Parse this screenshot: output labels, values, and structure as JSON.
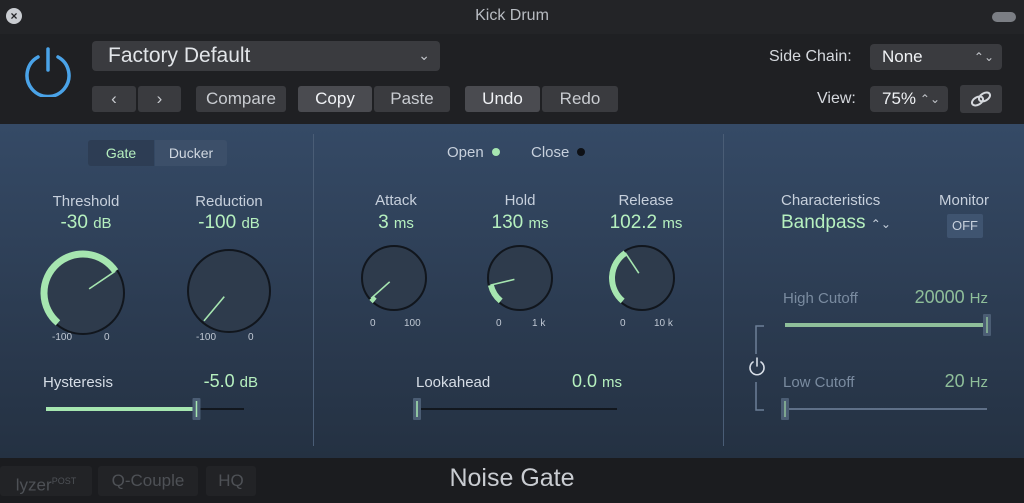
{
  "window": {
    "title": "Kick Drum",
    "plugin_name": "Noise Gate"
  },
  "header": {
    "preset": "Factory Default",
    "nav_prev": "‹",
    "nav_next": "›",
    "compare": "Compare",
    "copy": "Copy",
    "paste": "Paste",
    "undo": "Undo",
    "redo": "Redo",
    "side_chain_label": "Side Chain:",
    "side_chain_value": "None",
    "view_label": "View:",
    "view_value": "75%"
  },
  "mode": {
    "gate": "Gate",
    "ducker": "Ducker",
    "selected": "Gate"
  },
  "indicators": {
    "open": "Open",
    "close": "Close"
  },
  "knobs": {
    "threshold": {
      "label": "Threshold",
      "value": "-30",
      "unit": "dB",
      "min": "-100",
      "max": "0",
      "level": 0.7
    },
    "reduction": {
      "label": "Reduction",
      "value": "-100",
      "unit": "dB",
      "min": "-100",
      "max": "0",
      "level": 0.0
    },
    "attack": {
      "label": "Attack",
      "value": "3",
      "unit": "ms",
      "min": "0",
      "max": "100",
      "level": 0.03
    },
    "hold": {
      "label": "Hold",
      "value": "130",
      "unit": "ms",
      "min": "0",
      "max": "1 k",
      "level": 0.13
    },
    "release": {
      "label": "Release",
      "value": "102.2",
      "unit": "ms",
      "min": "0",
      "max": "10 k",
      "level": 0.38
    }
  },
  "hysteresis": {
    "label": "Hysteresis",
    "value": "-5.0",
    "unit": "dB",
    "level": 0.76
  },
  "lookahead": {
    "label": "Lookahead",
    "value": "0.0",
    "unit": "ms",
    "level": 0.0
  },
  "characteristics": {
    "label": "Characteristics",
    "value": "Bandpass"
  },
  "monitor": {
    "label": "Monitor",
    "value": "OFF"
  },
  "high_cutoff": {
    "label": "High Cutoff",
    "value": "20000",
    "unit": "Hz",
    "level": 1.0
  },
  "low_cutoff": {
    "label": "Low Cutoff",
    "value": "20",
    "unit": "Hz",
    "level": 0.0
  },
  "footer": {
    "analyzer": "lyzer",
    "post": "POST",
    "q_couple": "Q-Couple",
    "hq": "HQ"
  },
  "colors": {
    "accent_green": "#a6e6b0",
    "power_blue": "#4aa3e8",
    "panel_blue": "#354a66"
  }
}
